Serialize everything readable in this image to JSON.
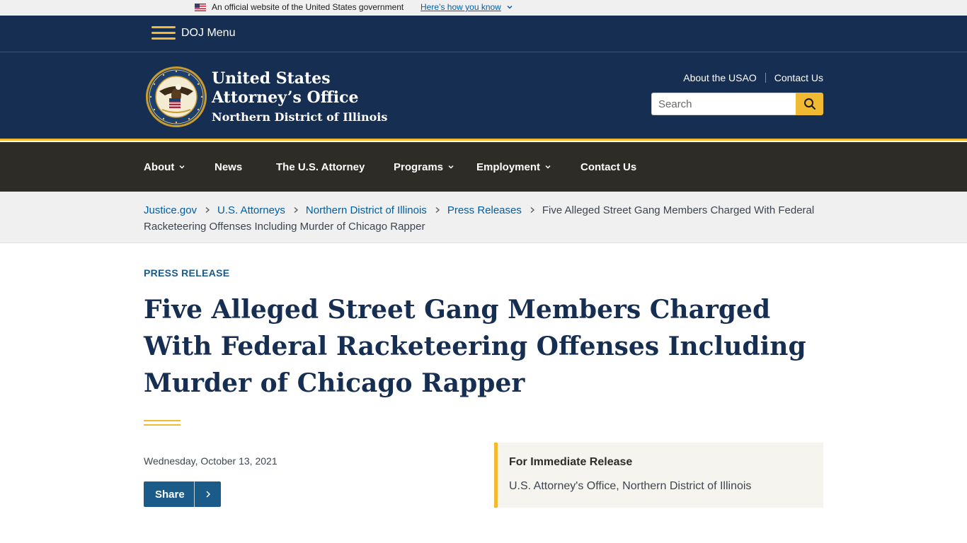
{
  "gov_banner": {
    "official_text": "An official website of the United States government",
    "how_you_know": "Here’s how you know"
  },
  "doj_bar": {
    "menu_label": "DOJ Menu"
  },
  "header": {
    "title_line1": "United States",
    "title_line2": "Attorney’s Office",
    "title_line3": "Northern District of Illinois",
    "utility_links": [
      "About the USAO",
      "Contact Us"
    ],
    "search_placeholder": "Search"
  },
  "nav": {
    "items": [
      {
        "label": "About",
        "has_dropdown": true
      },
      {
        "label": "News",
        "has_dropdown": false
      },
      {
        "label": "The U.S. Attorney",
        "has_dropdown": false
      },
      {
        "label": "Programs",
        "has_dropdown": true
      },
      {
        "label": "Employment",
        "has_dropdown": true
      },
      {
        "label": "Contact Us",
        "has_dropdown": false
      }
    ]
  },
  "breadcrumb": {
    "links": [
      "Justice.gov",
      "U.S. Attorneys",
      "Northern District of Illinois",
      "Press Releases"
    ],
    "current": "Five Alleged Street Gang Members Charged With Federal Racketeering Offenses Including Murder of Chicago Rapper"
  },
  "article": {
    "type_label": "PRESS RELEASE",
    "headline": "Five Alleged Street Gang Members Charged With Federal Racketeering Offenses Including Murder of Chicago Rapper",
    "date": "Wednesday, October 13, 2021",
    "share_label": "Share"
  },
  "release_box": {
    "title": "For Immediate Release",
    "office": "U.S. Attorney's Office, Northern District of Illinois"
  },
  "colors": {
    "navy": "#162e51",
    "gold": "#f2b933",
    "nav_dark": "#2d2c27",
    "link_blue": "#005ea2",
    "share_blue": "#1a5b8a"
  },
  "icons": [
    "us-flag-icon",
    "chevron-down-icon",
    "hamburger-icon",
    "doj-seal-icon",
    "search-icon",
    "chevron-right-icon"
  ]
}
